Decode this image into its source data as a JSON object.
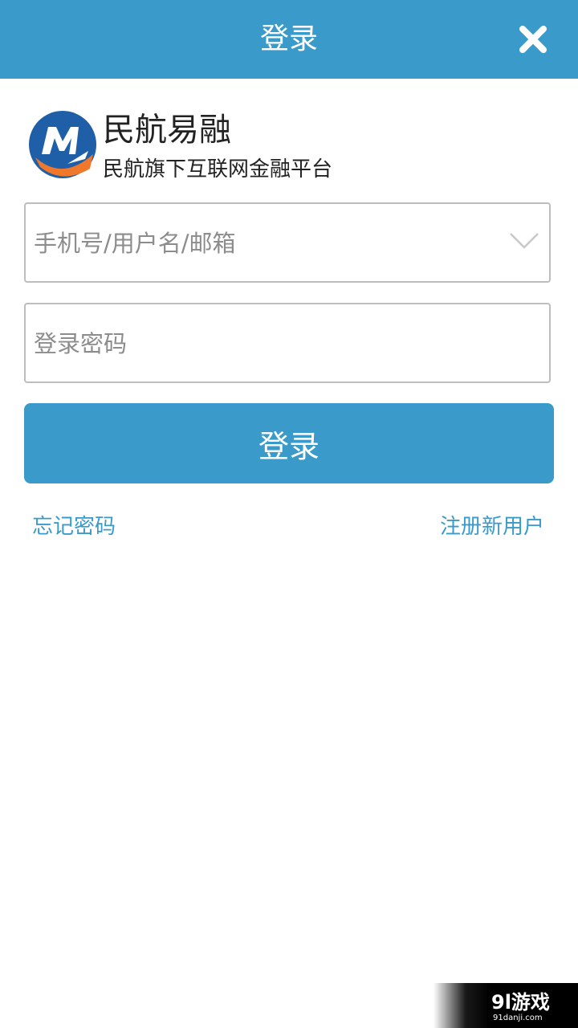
{
  "header": {
    "title": "登录"
  },
  "brand": {
    "name": "民航易融",
    "tagline": "民航旗下互联网金融平台"
  },
  "form": {
    "username_placeholder": "手机号/用户名/邮箱",
    "username_value": "",
    "password_placeholder": "登录密码",
    "password_value": "",
    "login_label": "登录"
  },
  "links": {
    "forgot_password": "忘记密码",
    "register": "注册新用户"
  },
  "watermark": {
    "text": "91游戏 91danji.com"
  },
  "colors": {
    "accent": "#3a9bcb",
    "logo_blue": "#1f5fa8",
    "logo_orange": "#f0782a",
    "text_dark": "#222222",
    "placeholder": "#8c8c8c",
    "border": "#bdbdbd"
  },
  "icons": {
    "close": "close-icon",
    "dropdown": "chevron-down-icon",
    "logo": "brand-logo-icon"
  }
}
